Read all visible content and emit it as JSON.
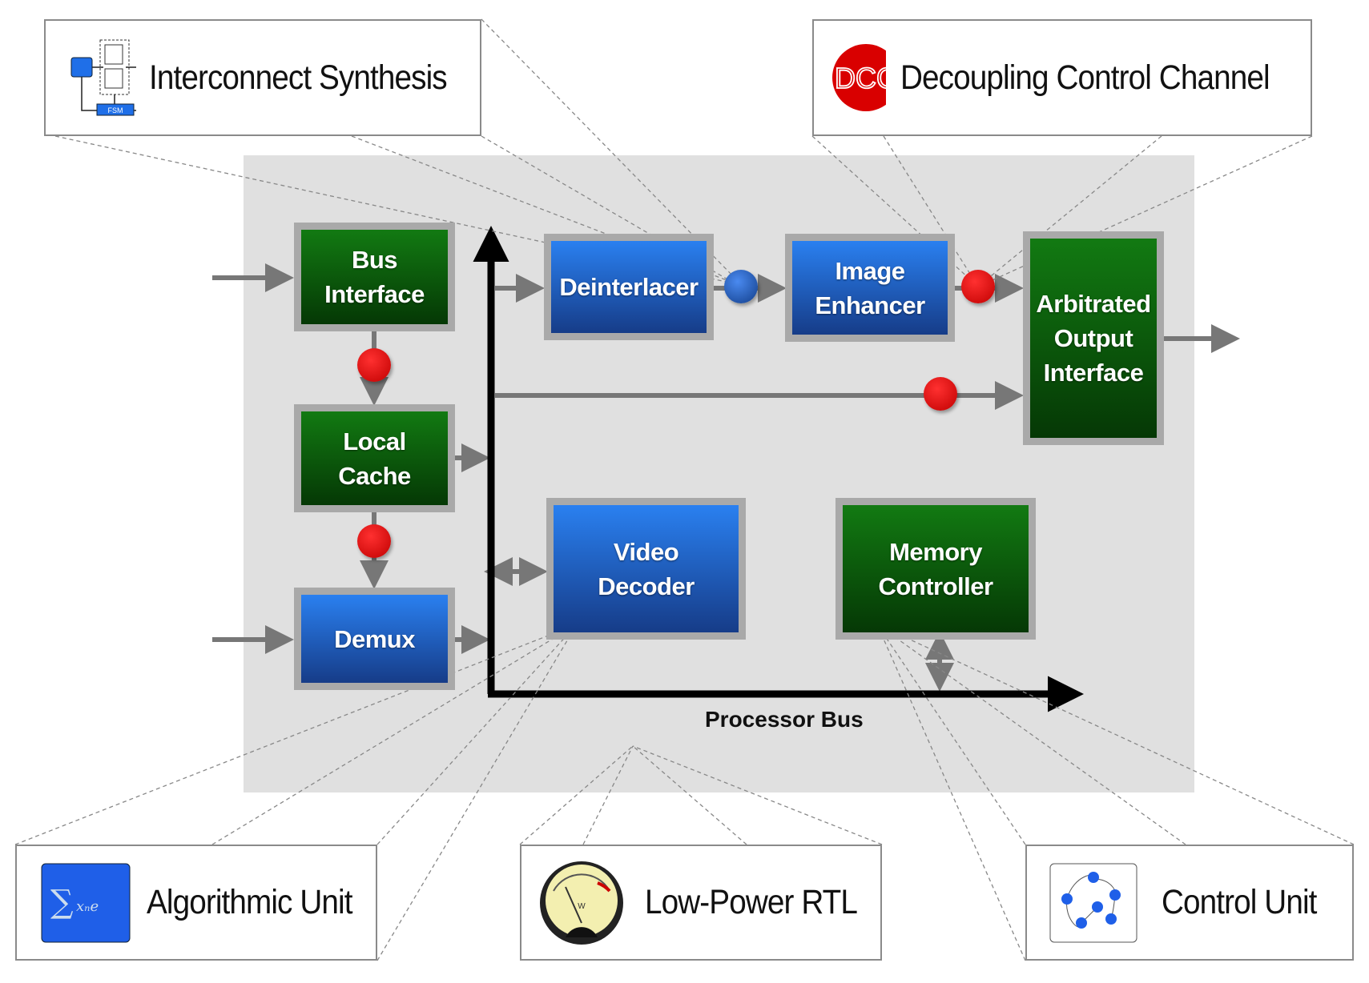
{
  "blocks": {
    "bus_interface": "Bus\nInterface",
    "local_cache": "Local\nCache",
    "demux": "Demux",
    "deinterlacer": "Deinterlacer",
    "image_enhancer": "Image\nEnhancer",
    "arbitrated_output": "Arbitrated\nOutput\nInterface",
    "video_decoder": "Video\nDecoder",
    "memory_controller": "Memory\nController"
  },
  "bus_label": "Processor Bus",
  "callouts": {
    "interconnect": {
      "label": "Interconnect Synthesis",
      "icon": "fsm-diagram-icon",
      "icon_text": "FSM"
    },
    "dcc": {
      "label": "Decoupling Control Channel",
      "icon": "dcc-icon",
      "icon_text": "DCC"
    },
    "algorithmic": {
      "label": "Algorithmic Unit",
      "icon": "dft-formula-icon"
    },
    "low_power": {
      "label": "Low-Power RTL",
      "icon": "power-meter-icon",
      "icon_text": "W"
    },
    "control": {
      "label": "Control Unit",
      "icon": "state-graph-icon"
    }
  },
  "colors": {
    "green_block": "#0d5e0d",
    "blue_block": "#1f5cc0",
    "red_channel": "#e00000",
    "panel": "#e0e0e0"
  }
}
